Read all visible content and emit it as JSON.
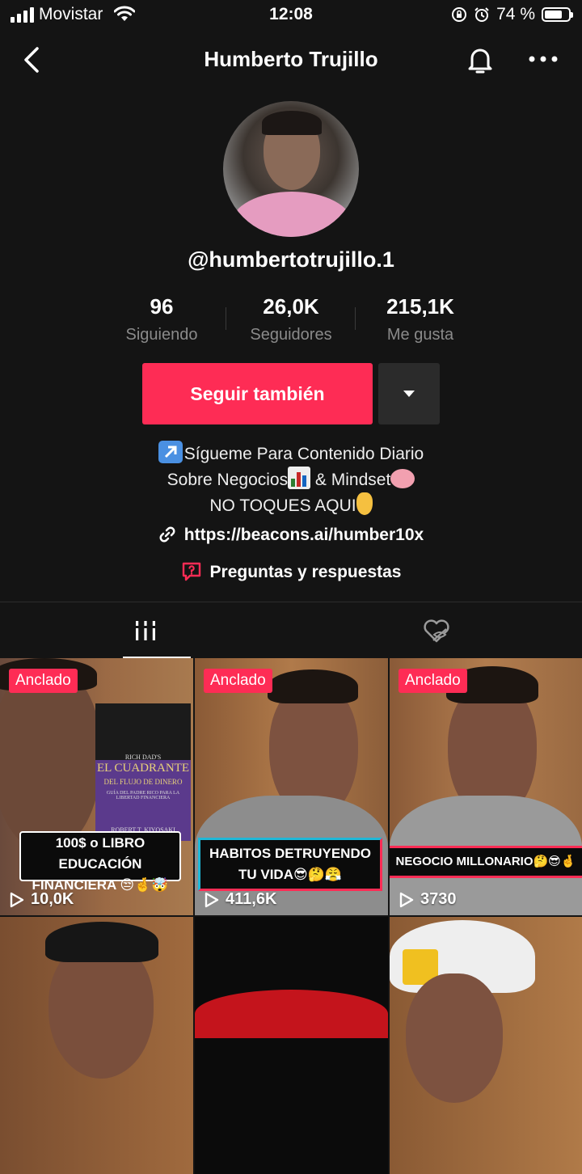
{
  "status_bar": {
    "carrier": "Movistar",
    "time": "12:08",
    "battery_pct": "74 %",
    "battery_level": 0.74
  },
  "header": {
    "title": "Humberto Trujillo"
  },
  "profile": {
    "username": "@humbertotrujillo.1",
    "stats": [
      {
        "value": "96",
        "label": "Siguiendo"
      },
      {
        "value": "26,0K",
        "label": "Seguidores"
      },
      {
        "value": "215,1K",
        "label": "Me gusta"
      }
    ],
    "follow_label": "Seguir también",
    "bio": {
      "line1": "Sígueme Para Contenido Diario",
      "line2a": "Sobre Negocios",
      "line2b": " & Mindset",
      "line3": "NO TOQUES AQUI"
    },
    "link": "https://beacons.ai/humber10x",
    "qa_label": "Preguntas y respuestas"
  },
  "colors": {
    "accent": "#fe2c55",
    "background": "#141414"
  },
  "videos": [
    {
      "pinned": "Anclado",
      "views": "10,0K",
      "caption_line1": "100$ o LIBRO EDUCACIÓN",
      "caption_line2": "FINANCIERA 😒🤞🤯",
      "book": {
        "brand": "RICH DAD'S",
        "title": "EL CUADRANTE",
        "subtitle": "DEL FLUJO DE DINERO",
        "tagline": "GUÍA DEL PADRE RICO PARA LA LIBERTAD FINANCIERA",
        "author": "ROBERT T. KIYOSAKI"
      }
    },
    {
      "pinned": "Anclado",
      "views": "411,6K",
      "caption_line1": "HABITOS DETRUYENDO",
      "caption_line2": "TU VIDA😎🤔😤"
    },
    {
      "pinned": "Anclado",
      "views": "3730",
      "caption_line1": "NEGOCIO MILLONARIO🤔😎🤞"
    },
    {
      "views": ""
    },
    {
      "views": ""
    },
    {
      "views": ""
    }
  ]
}
